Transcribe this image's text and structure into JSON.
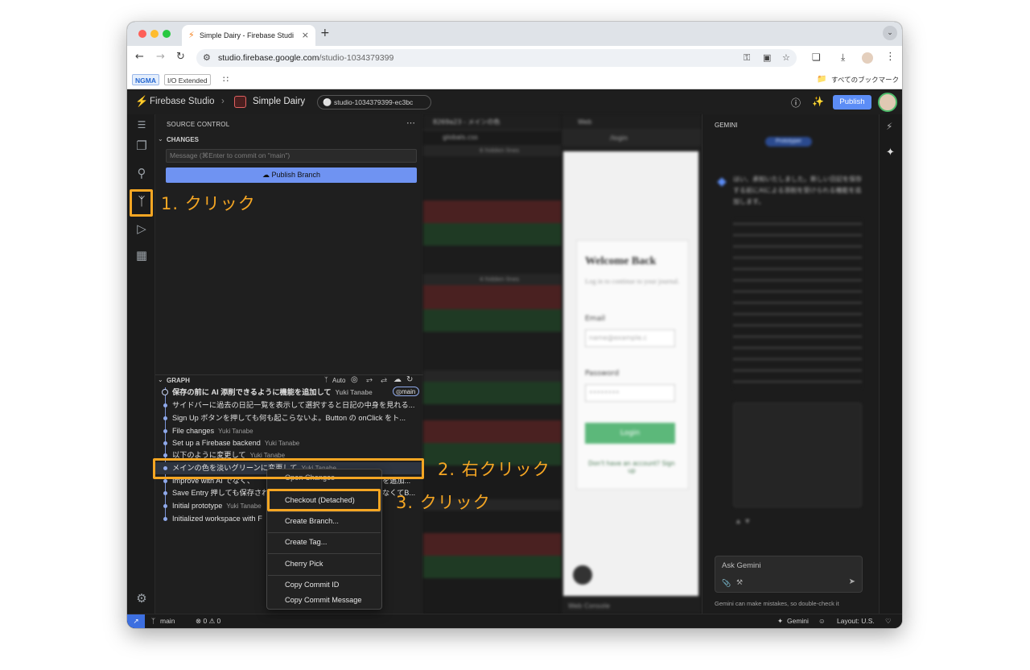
{
  "browser": {
    "tab_title": "Simple Dairy - Firebase Studi",
    "tab_close": "×",
    "new_tab": "+",
    "url_host": "studio.firebase.google.com",
    "url_path": "/studio-1034379399",
    "bookmarks": [
      "NGMA",
      "I/O Extended"
    ],
    "all_bookmarks": "すべてのブックマーク"
  },
  "app": {
    "product": "Firebase Studio",
    "project": "Simple Dairy",
    "workspace": "studio-1034379399-ec3bc",
    "publish": "Publish"
  },
  "source_control": {
    "title": "SOURCE CONTROL",
    "changes": "CHANGES",
    "message_placeholder": "Message (⌘Enter to commit on \"main\")",
    "publish_branch": "Publish Branch",
    "graph_title": "GRAPH",
    "graph_auto": "Auto",
    "commits": [
      {
        "msg": "保存の前に AI 添削できるように機能を追加して",
        "author": "Yuki Tanabe",
        "badge": "main"
      },
      {
        "msg": "サイドバーに過去の日記一覧を表示して選択すると日記の中身を見れる...",
        "author": ""
      },
      {
        "msg": "Sign Up ボタンを押しても何も起こらないよ。Button の onClick をト...",
        "author": ""
      },
      {
        "msg": "File changes",
        "author": "Yuki Tanabe"
      },
      {
        "msg": "Set up a Firebase backend",
        "author": "Yuki Tanabe"
      },
      {
        "msg": "以下のように変更して",
        "author": "Yuki Tanabe"
      },
      {
        "msg": "メインの色を淡いグリーンに変更して",
        "author": "Yuki Tanabe"
      },
      {
        "msg": "Improve with AI でなく、",
        "author": "を追加..."
      },
      {
        "msg": "Save Entry 押しても保存され",
        "author": "なくてB..."
      },
      {
        "msg": "Initial prototype",
        "author": "Yuki Tanabe"
      },
      {
        "msg": "Initialized workspace with F",
        "author": ""
      }
    ]
  },
  "context_menu": {
    "open_changes": "Open Changes",
    "checkout": "Checkout (Detached)",
    "create_branch": "Create Branch...",
    "create_tag": "Create Tag...",
    "cherry_pick": "Cherry Pick",
    "copy_id": "Copy Commit ID",
    "copy_message": "Copy Commit Message"
  },
  "annotations": {
    "step1": "1. クリック",
    "step2": "2. 右クリック",
    "step3": "3. クリック"
  },
  "editor": {
    "tab": "8269a23 - メインの色",
    "file": "globals.css",
    "hidden_lines": "6 hidden lines",
    "hidden_lines_2": "4 hidden lines"
  },
  "preview": {
    "tab": "Web",
    "path": "/login",
    "heading": "Welcome Back",
    "sub": "Log in to continue to your journal.",
    "email_label": "Email",
    "email_ph": "name@example.c",
    "password_label": "Password",
    "password_ph": "••••••••",
    "login": "Login",
    "signup": "Don't have an account? Sign up",
    "console": "Web Console"
  },
  "gemini": {
    "title": "GEMINI",
    "prototyper": "Prototyper",
    "ask_placeholder": "Ask Gemini",
    "disclaimer": "Gemini can make mistakes, so double-check it",
    "message": "はい、承知いたしました。新しい日記を保存する前にAIによる添削を受けられる機能を追加します。"
  },
  "status": {
    "branch": "main",
    "problems": "⊗ 0 ⚠ 0",
    "gemini": "Gemini",
    "layout": "Layout: U.S."
  }
}
